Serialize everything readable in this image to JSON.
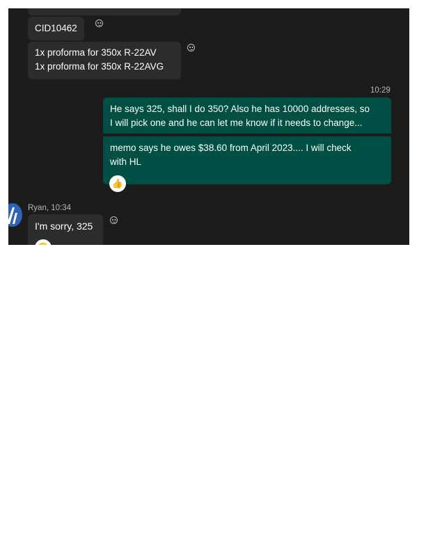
{
  "messages": {
    "cid": "CID10462",
    "proforma_lines": [
      "1x proforma for 350x R-22AV",
      "1x proforma for 350x R-22AVG"
    ],
    "outgoing_time": "10:29",
    "outgoing_1_lines": [
      "He says 325, shall I do 350?  Also he has 10000 addresses, so",
      "I will pick one and he can let me know if it needs to change..."
    ],
    "outgoing_2_lines": [
      "memo says he owes $38.60 from April 2023.... I will check",
      "with HL"
    ],
    "reaction_icon": "thumbs-up-icon",
    "reply_sender_line": "Ryan, 10:34",
    "reply_text": "I'm sorry, 325"
  }
}
